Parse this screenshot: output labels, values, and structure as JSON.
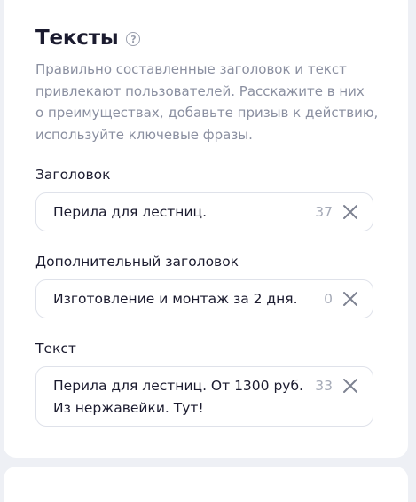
{
  "section": {
    "title": "Тексты",
    "help_icon": "question-circle-icon",
    "description_lines": [
      "Правильно составленные заголовок и текст",
      "привлекают пользователей. Расскажите в них",
      "о преимуществах, добавьте призыв к действию,",
      "используйте ключевые фразы."
    ]
  },
  "fields": {
    "headline": {
      "label": "Заголовок",
      "value": "Перила для лестниц.",
      "counter": "37",
      "clear_icon": "close-icon"
    },
    "subheadline": {
      "label": "Дополнительный заголовок",
      "value": "Изготовление и монтаж за 2 дня.",
      "counter": "0",
      "clear_icon": "close-icon"
    },
    "text": {
      "label": "Текст",
      "value_lines": [
        "Перила для лестниц. От 1300 руб.",
        "Из нержавейки. Тут!"
      ],
      "counter": "33",
      "clear_icon": "close-icon"
    }
  },
  "colors": {
    "page_background": "#eef0f5",
    "card_background": "#ffffff",
    "muted_text": "#8a8fa0",
    "border": "#dfe2ea"
  }
}
